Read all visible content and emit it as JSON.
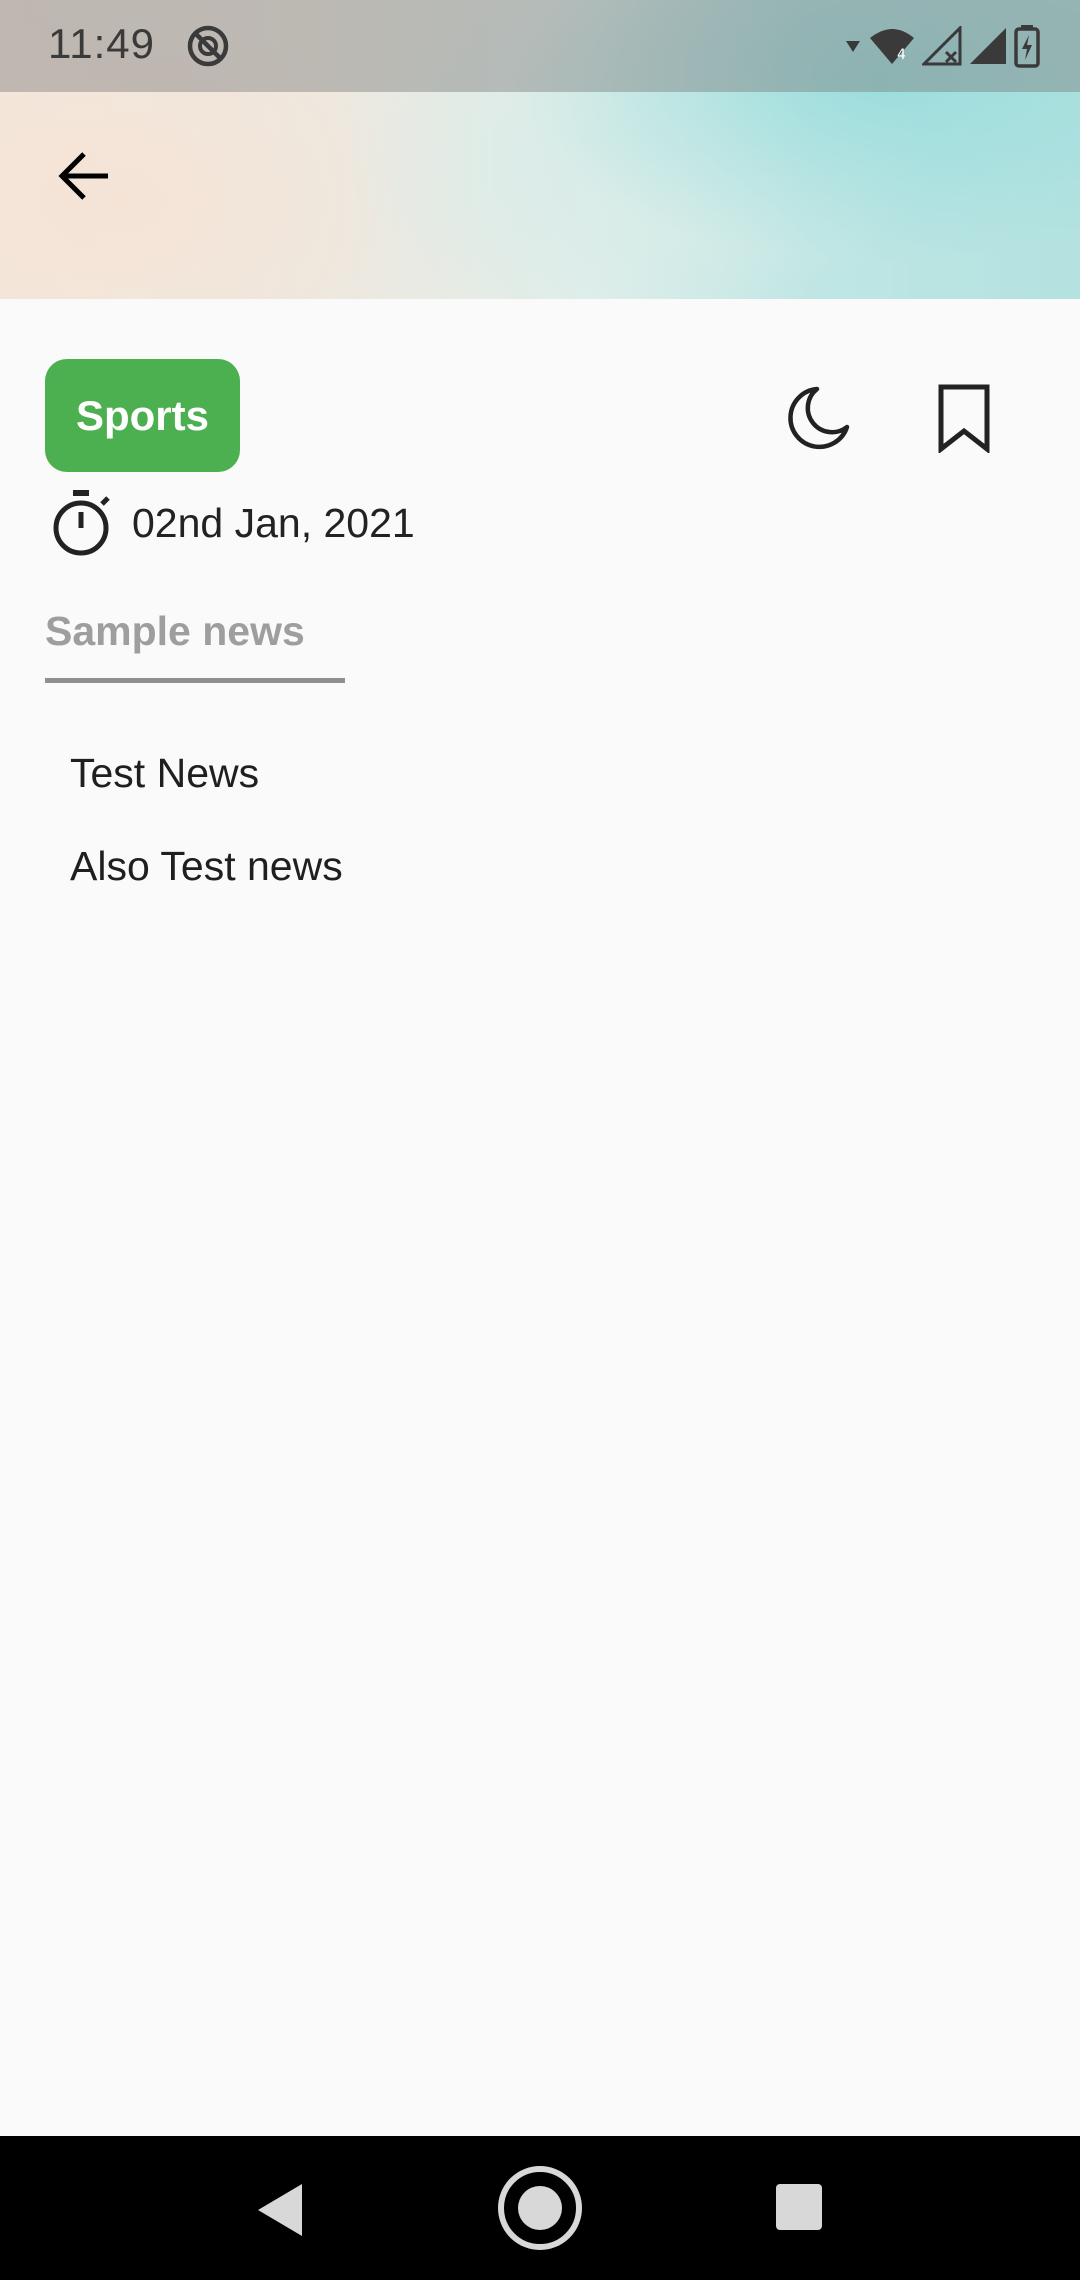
{
  "status_bar": {
    "time": "11:49",
    "icons": [
      "dnd-icon",
      "wifi-icon",
      "signal-icon",
      "signal-icon",
      "battery-charging-icon"
    ]
  },
  "header": {
    "back_icon": "arrow-back-icon"
  },
  "article": {
    "category": "Sports",
    "category_color": "#4caf50",
    "date": "02nd Jan, 2021",
    "actions": [
      "moon-icon",
      "bookmark-icon"
    ]
  },
  "tabs": [
    {
      "label": "Sample news"
    }
  ],
  "news_items": [
    {
      "title": "Test News"
    },
    {
      "title": "Also Test news"
    }
  ],
  "nav_bar": {
    "icons": [
      "nav-back-icon",
      "nav-home-icon",
      "nav-recents-icon"
    ]
  }
}
